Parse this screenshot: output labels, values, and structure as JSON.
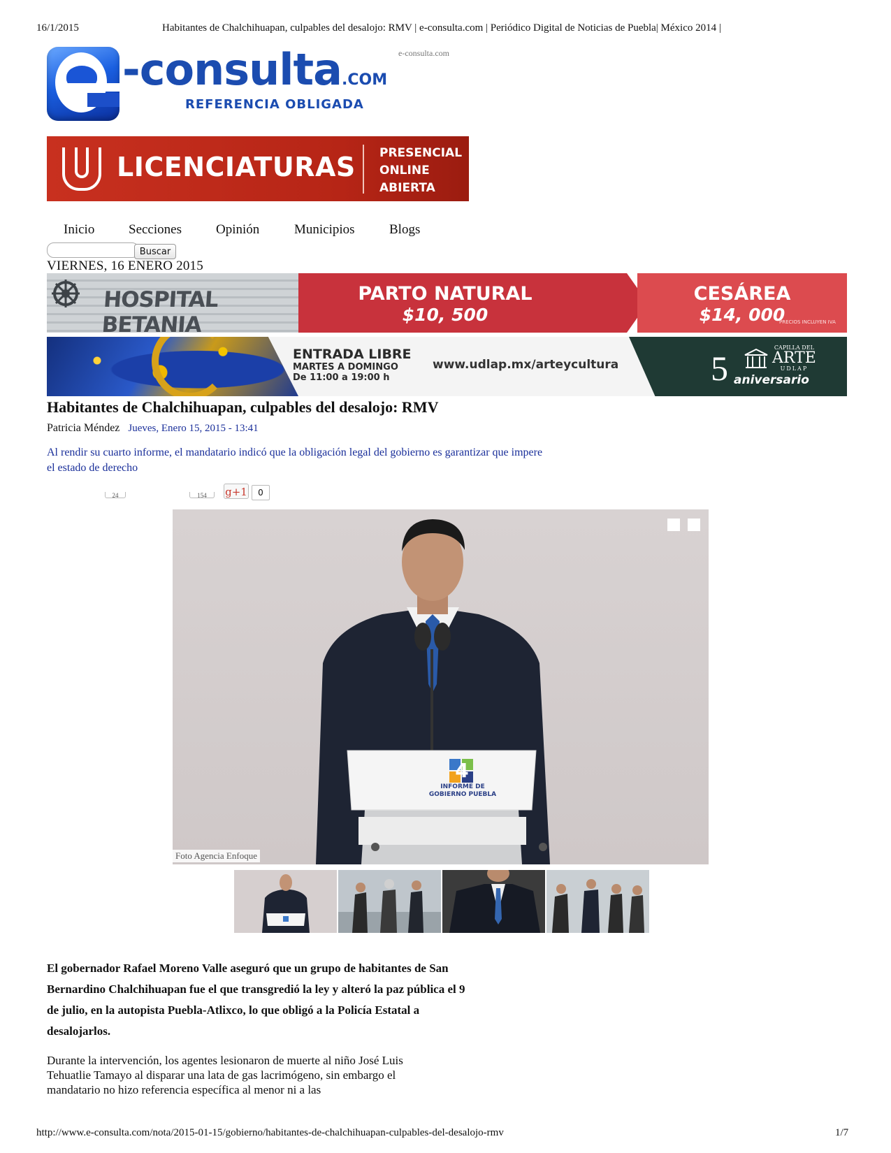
{
  "print": {
    "date": "16/1/2015",
    "title": "Habitantes de Chalchihuapan, culpables del desalojo: RMV | e-consulta.com | Periódico Digital de Noticias de Puebla| México 2014 |",
    "url": "http://www.e-consulta.com/nota/2015-01-15/gobierno/habitantes-de-chalchihuapan-culpables-del-desalojo-rmv",
    "page": "1/7"
  },
  "logo": {
    "word": "-consulta",
    "com": ".COM",
    "tagline": "REFERENCIA OBLIGADA",
    "caption": "e-consulta.com",
    "brand_color": "#1b4cb0"
  },
  "ads": {
    "licenciaturas": {
      "title": "LICENCIATURAS",
      "modes": [
        "PRESENCIAL",
        "ONLINE",
        "ABIERTA"
      ],
      "color": "#b62516"
    },
    "hospital": {
      "name": "HOSPITAL BETANIA",
      "offer1_label": "PARTO NATURAL",
      "offer1_price": "$10, 500",
      "offer2_label": "CESÁREA",
      "offer2_price": "$14, 000",
      "fine_print": "PRECIOS INCLUYEN IVA"
    },
    "udlap": {
      "entry_title": "ENTRADA LIBRE",
      "entry_days": "MARTES A DOMINGO",
      "entry_hours": "De 11:00 a 19:00 h",
      "url": "www.udlap.mx/arteycultura",
      "number": "5",
      "anniversary": "aniversario",
      "capilla_top": "CAPILLA DEL",
      "capilla_main": "ARTE",
      "capilla_bottom": "UDLAP"
    }
  },
  "nav": {
    "items": [
      "Inicio",
      "Secciones",
      "Opinión",
      "Municipios",
      "Blogs"
    ]
  },
  "search": {
    "placeholder": "",
    "button": "Buscar"
  },
  "date_line": "VIERNES, 16 ENERO 2015",
  "article": {
    "title": "Habitantes de Chalchihuapan, culpables del desalojo: RMV",
    "author": "Patricia Méndez",
    "date": "Jueves, Enero 15, 2015 - 13:41",
    "lede": "Al rendir su cuarto informe, el mandatario indicó que la obligación legal del gobierno es garantizar que impere el estado de derecho",
    "social": {
      "count_a": "24",
      "count_b": "154",
      "gplus_label": "g+1",
      "gplus_count": "0"
    },
    "photo_caption": "Foto Agencia Enfoque",
    "podium_text": "INFORME DE GOBIERNO PUEBLA",
    "podium_number": "4",
    "lead_paragraph": "El gobernador Rafael Moreno Valle aseguró que un grupo de habitantes de San Bernardino Chalchihuapan fue el que transgredió la ley y alteró la paz pública el 9 de julio, en la autopista Puebla-Atlixco, lo que obligó a la Policía Estatal a desalojarlos.",
    "paragraph": "Durante la intervención, los agentes lesionaron de muerte al niño José Luis Tehuatlie Tamayo al disparar una lata de gas lacrimógeno, sin embargo el mandatario no hizo referencia específica al menor ni a las"
  }
}
